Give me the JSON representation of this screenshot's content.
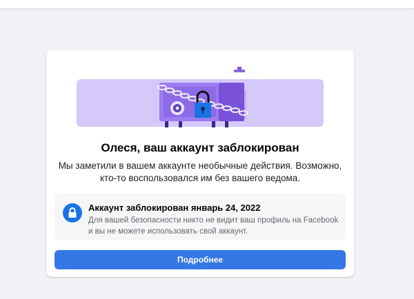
{
  "card": {
    "title": "Олеся, ваш аккаунт заблокирован",
    "description": "Мы заметили в вашем аккаунте необычные действия. Возможно, кто-то воспользовался им без вашего ведома.",
    "notice": {
      "title": "Аккаунт заблокирован январь 24, 2022",
      "text": "Для вашей безопасности никто не видит ваш профиль на Facebook и вы не можете использовать свой аккаунт.",
      "icon": "lock-icon"
    },
    "button_label": "Подробнее",
    "illustration_icon": "locked-safe-illustration"
  },
  "colors": {
    "page_background": "#f0f2f5",
    "card_background": "#ffffff",
    "accent": "#1b74e4",
    "button": "#3577e5",
    "illustration_band": "#d4c9f9",
    "safe": "#9d7bf0"
  }
}
